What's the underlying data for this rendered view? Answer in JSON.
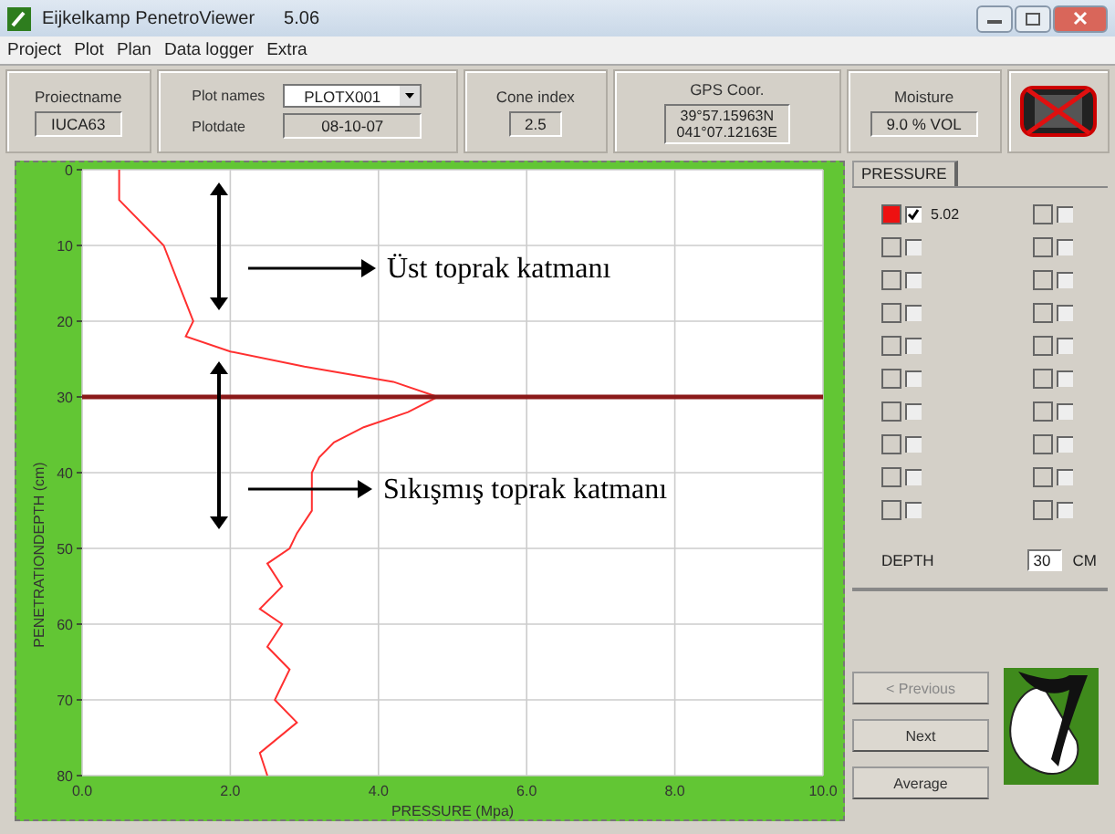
{
  "window": {
    "title": "Eijkelkamp PenetroViewer",
    "version": "5.06"
  },
  "menu": [
    "Project",
    "Plot",
    "Plan",
    "Data logger",
    "Extra"
  ],
  "info": {
    "project": {
      "label": "Proiectname",
      "value": "IUCA63"
    },
    "plot_name": {
      "label": "Plot names",
      "value": "PLOTX001"
    },
    "plot_date": {
      "label": "Plotdate",
      "value": "08-10-07"
    },
    "cone_index": {
      "label": "Cone index",
      "value": "2.5"
    },
    "gps": {
      "label": "GPS Coor.",
      "lines": [
        "39°57.15963N",
        "041°07.12163E"
      ]
    },
    "moisture": {
      "label": "Moisture",
      "value": "9.0 % VOL"
    }
  },
  "chart": {
    "chart_data": {
      "type": "line",
      "xlabel": "PRESSURE (Mpa)",
      "ylabel": "PENETRATIONDEPTH (cm)",
      "x": [
        0.5,
        0.5,
        1.1,
        1.3,
        1.5,
        1.4,
        2.0,
        3.0,
        4.2,
        4.8,
        4.4,
        3.8,
        3.4,
        3.2,
        3.1,
        3.1,
        2.9,
        2.8,
        2.5,
        2.7,
        2.4,
        2.7,
        2.5,
        2.8,
        2.6,
        2.9,
        2.4,
        2.5
      ],
      "series": [
        {
          "color": "#ff3030",
          "values": [
            0,
            4,
            10,
            15,
            20,
            22,
            24,
            26,
            28,
            30,
            32,
            34,
            36,
            38,
            40,
            45,
            48,
            50,
            52,
            55,
            58,
            60,
            63,
            66,
            70,
            73,
            77,
            80
          ]
        }
      ],
      "xlim": [
        0,
        10
      ],
      "ylim": [
        80,
        0
      ],
      "grid": true,
      "ref_lines": [
        {
          "axis": "y",
          "value": 30,
          "color": "#8b1a1a"
        }
      ],
      "xticks": [
        {
          "value": 0,
          "label": "0.0"
        },
        {
          "value": 2,
          "label": "2.0"
        },
        {
          "value": 4,
          "label": "4.0"
        },
        {
          "value": 6,
          "label": "6.0"
        },
        {
          "value": 8,
          "label": "8.0"
        },
        {
          "value": 10,
          "label": "10.0"
        }
      ],
      "yticks": [
        0,
        10,
        20,
        30,
        40,
        50,
        60,
        70,
        80
      ]
    },
    "annotations": [
      {
        "text": "Üst toprak katmanı"
      },
      {
        "text": "Sıkışmış toprak katmanı"
      }
    ]
  },
  "panel": {
    "tab": "PRESSURE",
    "items": [
      {
        "color": "#ee1111",
        "checked": true,
        "value": "5.02"
      },
      {
        "checked": false
      },
      {
        "checked": false
      },
      {
        "checked": false
      },
      {
        "checked": false
      },
      {
        "checked": false
      },
      {
        "checked": false
      },
      {
        "checked": false
      },
      {
        "checked": false
      },
      {
        "checked": false
      },
      {
        "checked": false
      },
      {
        "checked": false
      },
      {
        "checked": false
      },
      {
        "checked": false
      },
      {
        "checked": false
      },
      {
        "checked": false
      },
      {
        "checked": false
      },
      {
        "checked": false
      },
      {
        "checked": false
      },
      {
        "checked": false
      }
    ],
    "depth": {
      "label": "DEPTH",
      "value": "30",
      "unit": "CM"
    },
    "buttons": [
      {
        "label": "< Previous",
        "disabled": true
      },
      {
        "label": "Next",
        "disabled": false
      },
      {
        "label": "Average",
        "disabled": false
      }
    ]
  }
}
